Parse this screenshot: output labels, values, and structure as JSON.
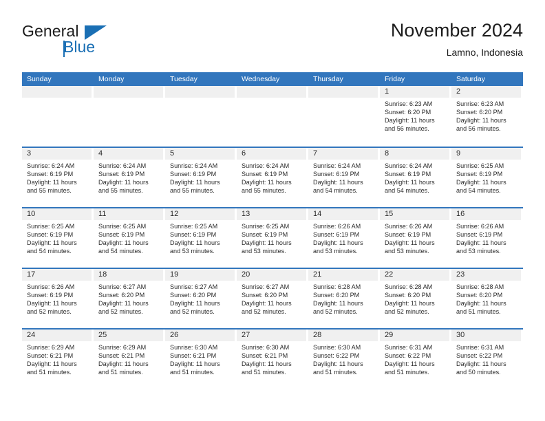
{
  "brand": {
    "name_part1": "General",
    "name_part2": "Blue"
  },
  "header": {
    "title": "November 2024",
    "location": "Lamno, Indonesia"
  },
  "colors": {
    "header_blue": "#3276bd",
    "brand_blue": "#1a6fb4",
    "day_header_gray": "#f0f0f0"
  },
  "weekdays": [
    "Sunday",
    "Monday",
    "Tuesday",
    "Wednesday",
    "Thursday",
    "Friday",
    "Saturday"
  ],
  "weeks": [
    [
      {
        "day": "",
        "empty": true
      },
      {
        "day": "",
        "empty": true
      },
      {
        "day": "",
        "empty": true
      },
      {
        "day": "",
        "empty": true
      },
      {
        "day": "",
        "empty": true
      },
      {
        "day": "1",
        "sunrise": "Sunrise: 6:23 AM",
        "sunset": "Sunset: 6:20 PM",
        "daylight": "Daylight: 11 hours and 56 minutes."
      },
      {
        "day": "2",
        "sunrise": "Sunrise: 6:23 AM",
        "sunset": "Sunset: 6:20 PM",
        "daylight": "Daylight: 11 hours and 56 minutes."
      }
    ],
    [
      {
        "day": "3",
        "sunrise": "Sunrise: 6:24 AM",
        "sunset": "Sunset: 6:19 PM",
        "daylight": "Daylight: 11 hours and 55 minutes."
      },
      {
        "day": "4",
        "sunrise": "Sunrise: 6:24 AM",
        "sunset": "Sunset: 6:19 PM",
        "daylight": "Daylight: 11 hours and 55 minutes."
      },
      {
        "day": "5",
        "sunrise": "Sunrise: 6:24 AM",
        "sunset": "Sunset: 6:19 PM",
        "daylight": "Daylight: 11 hours and 55 minutes."
      },
      {
        "day": "6",
        "sunrise": "Sunrise: 6:24 AM",
        "sunset": "Sunset: 6:19 PM",
        "daylight": "Daylight: 11 hours and 55 minutes."
      },
      {
        "day": "7",
        "sunrise": "Sunrise: 6:24 AM",
        "sunset": "Sunset: 6:19 PM",
        "daylight": "Daylight: 11 hours and 54 minutes."
      },
      {
        "day": "8",
        "sunrise": "Sunrise: 6:24 AM",
        "sunset": "Sunset: 6:19 PM",
        "daylight": "Daylight: 11 hours and 54 minutes."
      },
      {
        "day": "9",
        "sunrise": "Sunrise: 6:25 AM",
        "sunset": "Sunset: 6:19 PM",
        "daylight": "Daylight: 11 hours and 54 minutes."
      }
    ],
    [
      {
        "day": "10",
        "sunrise": "Sunrise: 6:25 AM",
        "sunset": "Sunset: 6:19 PM",
        "daylight": "Daylight: 11 hours and 54 minutes."
      },
      {
        "day": "11",
        "sunrise": "Sunrise: 6:25 AM",
        "sunset": "Sunset: 6:19 PM",
        "daylight": "Daylight: 11 hours and 54 minutes."
      },
      {
        "day": "12",
        "sunrise": "Sunrise: 6:25 AM",
        "sunset": "Sunset: 6:19 PM",
        "daylight": "Daylight: 11 hours and 53 minutes."
      },
      {
        "day": "13",
        "sunrise": "Sunrise: 6:25 AM",
        "sunset": "Sunset: 6:19 PM",
        "daylight": "Daylight: 11 hours and 53 minutes."
      },
      {
        "day": "14",
        "sunrise": "Sunrise: 6:26 AM",
        "sunset": "Sunset: 6:19 PM",
        "daylight": "Daylight: 11 hours and 53 minutes."
      },
      {
        "day": "15",
        "sunrise": "Sunrise: 6:26 AM",
        "sunset": "Sunset: 6:19 PM",
        "daylight": "Daylight: 11 hours and 53 minutes."
      },
      {
        "day": "16",
        "sunrise": "Sunrise: 6:26 AM",
        "sunset": "Sunset: 6:19 PM",
        "daylight": "Daylight: 11 hours and 53 minutes."
      }
    ],
    [
      {
        "day": "17",
        "sunrise": "Sunrise: 6:26 AM",
        "sunset": "Sunset: 6:19 PM",
        "daylight": "Daylight: 11 hours and 52 minutes."
      },
      {
        "day": "18",
        "sunrise": "Sunrise: 6:27 AM",
        "sunset": "Sunset: 6:20 PM",
        "daylight": "Daylight: 11 hours and 52 minutes."
      },
      {
        "day": "19",
        "sunrise": "Sunrise: 6:27 AM",
        "sunset": "Sunset: 6:20 PM",
        "daylight": "Daylight: 11 hours and 52 minutes."
      },
      {
        "day": "20",
        "sunrise": "Sunrise: 6:27 AM",
        "sunset": "Sunset: 6:20 PM",
        "daylight": "Daylight: 11 hours and 52 minutes."
      },
      {
        "day": "21",
        "sunrise": "Sunrise: 6:28 AM",
        "sunset": "Sunset: 6:20 PM",
        "daylight": "Daylight: 11 hours and 52 minutes."
      },
      {
        "day": "22",
        "sunrise": "Sunrise: 6:28 AM",
        "sunset": "Sunset: 6:20 PM",
        "daylight": "Daylight: 11 hours and 52 minutes."
      },
      {
        "day": "23",
        "sunrise": "Sunrise: 6:28 AM",
        "sunset": "Sunset: 6:20 PM",
        "daylight": "Daylight: 11 hours and 51 minutes."
      }
    ],
    [
      {
        "day": "24",
        "sunrise": "Sunrise: 6:29 AM",
        "sunset": "Sunset: 6:21 PM",
        "daylight": "Daylight: 11 hours and 51 minutes."
      },
      {
        "day": "25",
        "sunrise": "Sunrise: 6:29 AM",
        "sunset": "Sunset: 6:21 PM",
        "daylight": "Daylight: 11 hours and 51 minutes."
      },
      {
        "day": "26",
        "sunrise": "Sunrise: 6:30 AM",
        "sunset": "Sunset: 6:21 PM",
        "daylight": "Daylight: 11 hours and 51 minutes."
      },
      {
        "day": "27",
        "sunrise": "Sunrise: 6:30 AM",
        "sunset": "Sunset: 6:21 PM",
        "daylight": "Daylight: 11 hours and 51 minutes."
      },
      {
        "day": "28",
        "sunrise": "Sunrise: 6:30 AM",
        "sunset": "Sunset: 6:22 PM",
        "daylight": "Daylight: 11 hours and 51 minutes."
      },
      {
        "day": "29",
        "sunrise": "Sunrise: 6:31 AM",
        "sunset": "Sunset: 6:22 PM",
        "daylight": "Daylight: 11 hours and 51 minutes."
      },
      {
        "day": "30",
        "sunrise": "Sunrise: 6:31 AM",
        "sunset": "Sunset: 6:22 PM",
        "daylight": "Daylight: 11 hours and 50 minutes."
      }
    ]
  ]
}
